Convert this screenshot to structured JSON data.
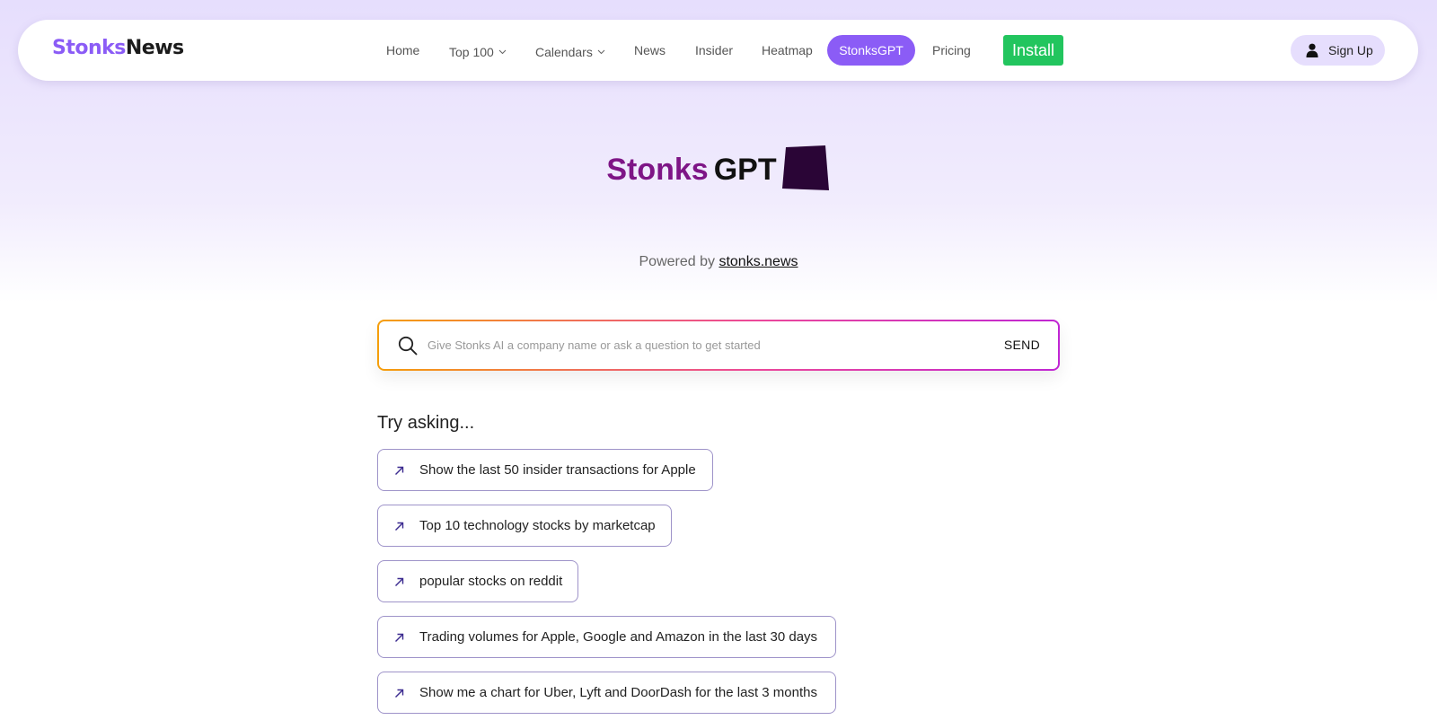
{
  "brand": {
    "part1": "Stonks",
    "part2": "News"
  },
  "nav": {
    "home": "Home",
    "top100": "Top 100",
    "calendars": "Calendars",
    "news": "News",
    "insider": "Insider",
    "heatmap": "Heatmap",
    "stonksgpt": "StonksGPT",
    "pricing": "Pricing",
    "install": "Install",
    "signup": "Sign Up"
  },
  "hero": {
    "title_part1": "Stonks",
    "title_part2": "GPT",
    "powered_prefix": "Powered by",
    "powered_link": "stonks.news"
  },
  "search": {
    "placeholder": "Give Stonks AI a company name or ask a question to get started",
    "value": "",
    "send_label": "SEND"
  },
  "suggestions": {
    "title": "Try asking...",
    "items": [
      "Show the last 50 insider transactions for Apple",
      "Top 10 technology stocks by marketcap",
      "popular stocks on reddit",
      "Trading volumes for Apple, Google and Amazon in the last 30 days",
      "Show me a chart for Uber, Lyft and DoorDash for the last 3 months"
    ]
  },
  "colors": {
    "accent_purple": "#8b5cf6",
    "title_purple": "#7e1586",
    "install_green": "#22c55e",
    "logo_dark": "#2a0536"
  },
  "icons": {
    "search": "search-icon",
    "user": "user-icon",
    "suggestion": "arrow-up-right-icon",
    "chevron": "chevron-down-icon",
    "logo": "stonks-gpt-logo-icon"
  }
}
